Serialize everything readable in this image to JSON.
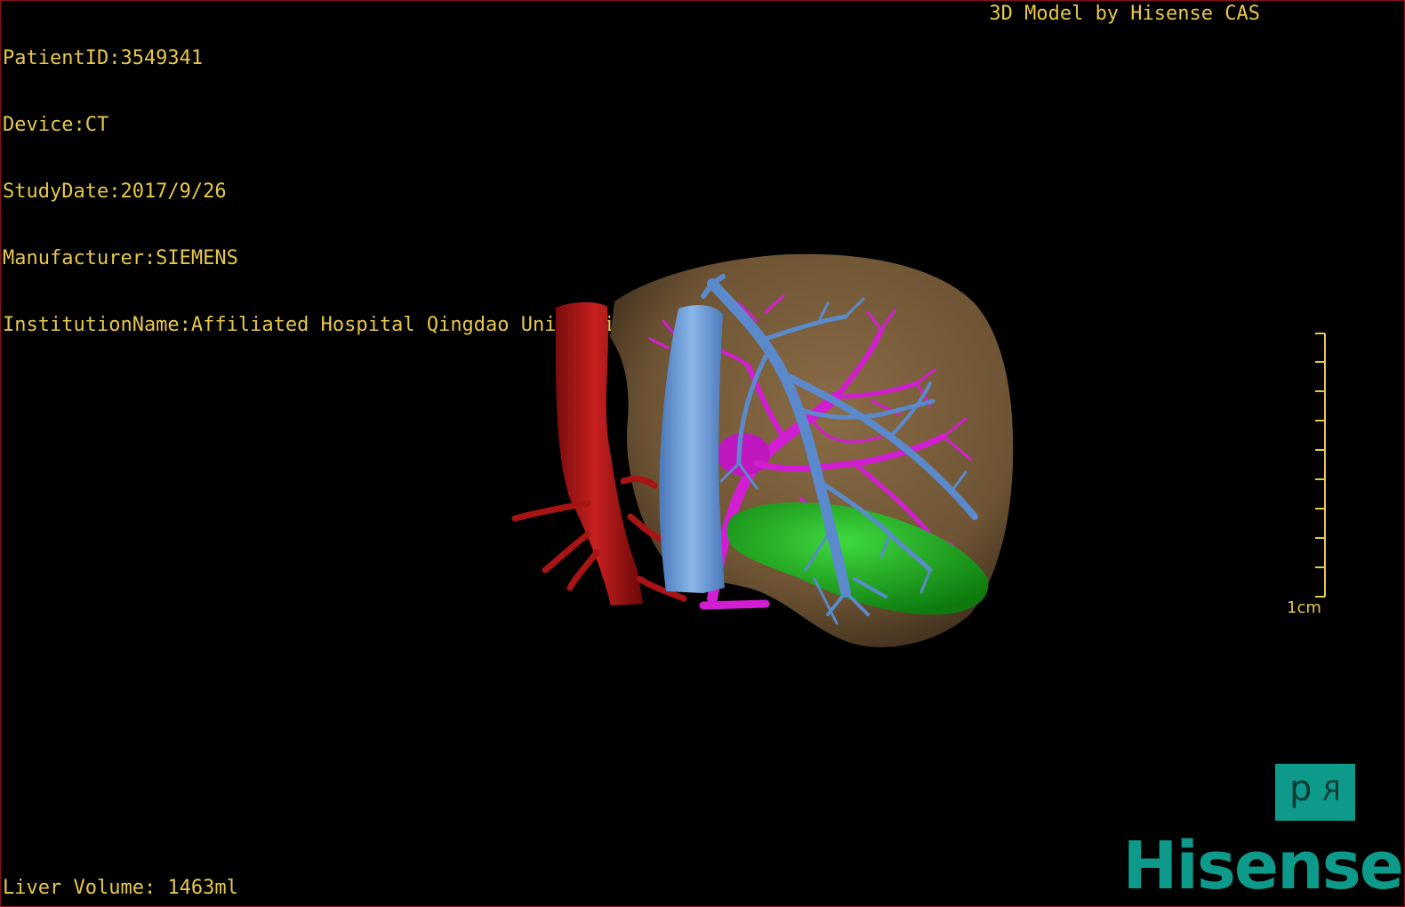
{
  "info": {
    "patient_id": "PatientID:3549341",
    "device": "Device:CT",
    "study_date": "StudyDate:2017/9/26",
    "manufacturer": "Manufacturer:SIEMENS",
    "institution": "InstitutionName:Affiliated Hospital Qingdao University-C"
  },
  "model_credit": "3D Model by Hisense CAS",
  "liver_volume": "Liver Volume: 1463ml",
  "scale": {
    "label": "1cm"
  },
  "orientation": {
    "left": "d",
    "right": "R"
  },
  "brand": "Hisense",
  "colors": {
    "text": "#e8c84a",
    "liver": "#7a5f3c",
    "artery": "#b01818",
    "vena_cava": "#6e9fd8",
    "portal_vein": "#d020d0",
    "hepatic_vein": "#5a8acc",
    "gallbladder": "#18a818",
    "brand": "#0d9a8a"
  }
}
